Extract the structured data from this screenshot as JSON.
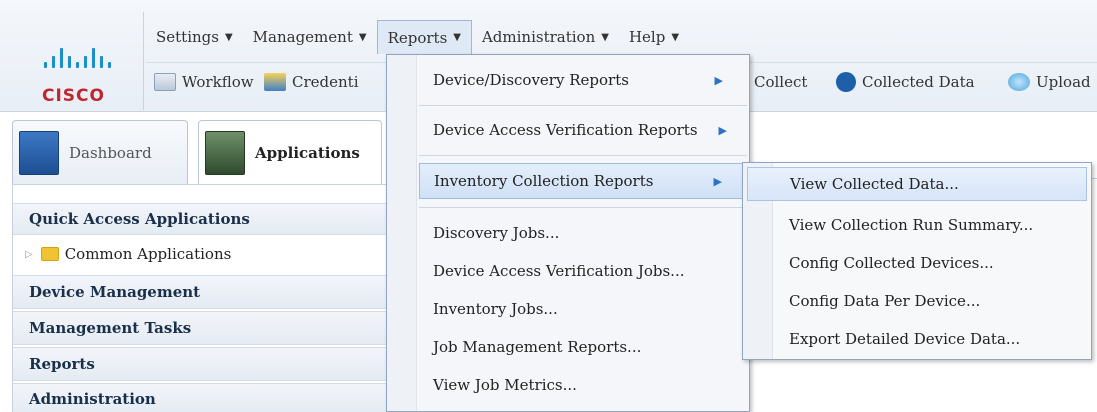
{
  "brand": {
    "logo_text": "CISCO",
    "logo_color": "#c0262d",
    "bars_color": "#1b8fc9"
  },
  "menubar": [
    {
      "label": "Settings",
      "name": "menu-settings"
    },
    {
      "label": "Management",
      "name": "menu-management"
    },
    {
      "label": "Reports",
      "name": "menu-reports",
      "active": true
    },
    {
      "label": "Administration",
      "name": "menu-administration"
    },
    {
      "label": "Help",
      "name": "menu-help"
    }
  ],
  "toolbar": {
    "workflow": "Workflow",
    "credentials": "Credenti",
    "collect": "Collect",
    "collected_data": "Collected Data",
    "upload": "Upload"
  },
  "tabs": {
    "dashboard": "Dashboard",
    "applications": "Applications"
  },
  "leftpanel": {
    "quick_access": "Quick Access Applications",
    "common_apps": "Common Applications",
    "device_management": "Device Management",
    "management_tasks": "Management Tasks",
    "reports": "Reports",
    "administration": "Administration"
  },
  "reports_menu": {
    "items": [
      "Device/Discovery Reports",
      "Device Access Verification Reports",
      "Inventory Collection Reports",
      "Discovery Jobs...",
      "Device Access Verification Jobs...",
      "Inventory Jobs...",
      "Job Management Reports...",
      "View Job Metrics..."
    ]
  },
  "inventory_submenu": {
    "items": [
      "View Collected Data...",
      "View Collection Run Summary...",
      "Config Collected Devices...",
      "Config Data Per Device...",
      "Export Detailed Device Data..."
    ]
  },
  "icons": {
    "caret": "▼",
    "submenu_arrow": "▶",
    "tree_collapsed": "▷"
  },
  "colors": {
    "accent": "#2d73c4",
    "section_text": "#1a2f4a",
    "menu_hover": "#cfe0f6"
  }
}
